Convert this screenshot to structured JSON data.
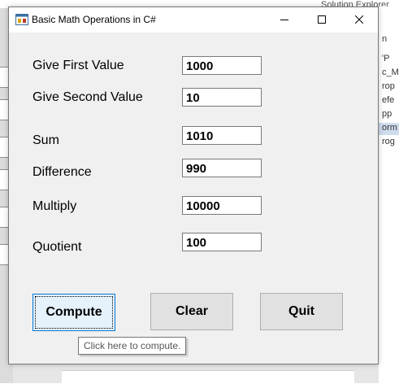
{
  "background": {
    "top_right_text": "Solution Explorer",
    "right_lines": [
      "n",
      "'P",
      "c_M",
      "rop",
      "efe",
      "pp",
      "orm",
      "rog"
    ]
  },
  "window": {
    "title": "Basic Math Operations in C#"
  },
  "form": {
    "first_label": "Give First Value",
    "first_value": "1000",
    "second_label": "Give Second Value",
    "second_value": "10",
    "sum_label": "Sum",
    "sum_value": "1010",
    "difference_label": "Difference",
    "difference_value": "990",
    "multiply_label": "Multiply",
    "multiply_value": "10000",
    "quotient_label": "Quotient",
    "quotient_value": "100"
  },
  "buttons": {
    "compute": "Compute",
    "clear": "Clear",
    "quit": "Quit"
  },
  "tooltip": "Click here to compute."
}
